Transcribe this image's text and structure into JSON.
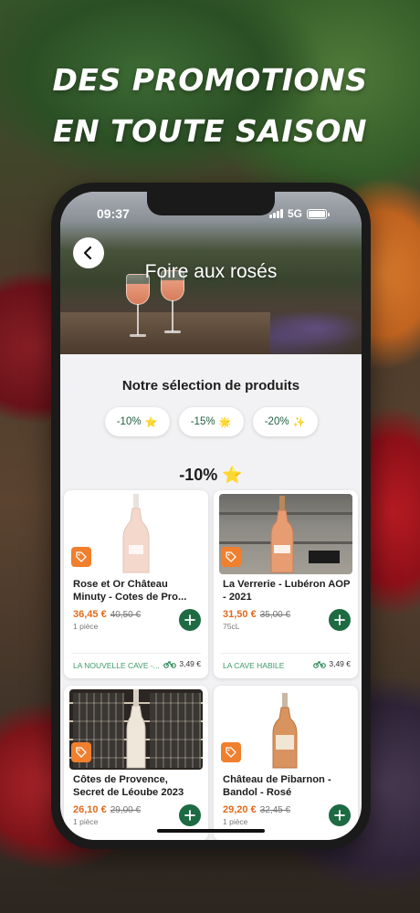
{
  "headline": {
    "line1": "DES PROMOTIONS",
    "line2": "EN TOUTE SAISON"
  },
  "status_bar": {
    "time": "09:37",
    "network": "5G"
  },
  "page": {
    "title": "Foire aux rosés"
  },
  "selection": {
    "title": "Notre sélection de produits",
    "chips": [
      {
        "label": "-10%",
        "emoji": "⭐"
      },
      {
        "label": "-15%",
        "emoji": "🌟"
      },
      {
        "label": "-20%",
        "emoji": "✨"
      }
    ]
  },
  "group": {
    "title": "-10%",
    "emoji": "⭐"
  },
  "products": [
    {
      "name": "Rose et Or Château Minuty - Cotes de Pro...",
      "price": "36,45 €",
      "old_price": "40,50 €",
      "unit": "1 pièce",
      "shop": "LA NOUVELLE CAVE -...",
      "delivery_fee": "3,49 €"
    },
    {
      "name": "La Verrerie - Lubéron AOP - 2021",
      "price": "31,50 €",
      "old_price": "35,00 €",
      "unit": "75cL",
      "shop": "LA CAVE HABILE",
      "delivery_fee": "3,49 €"
    },
    {
      "name": "Côtes de Provence, Secret de Léoube 2023",
      "price": "26,10 €",
      "old_price": "29,00 €",
      "unit": "1 pièce"
    },
    {
      "name": "Château de Pibarnon - Bandol - Rosé",
      "price": "29,20 €",
      "old_price": "32,45 €",
      "unit": "1 pièce"
    }
  ],
  "colors": {
    "accent_green": "#1d6a43",
    "price_orange": "#e26a1c",
    "tag_orange": "#f07f2e",
    "shop_green": "#3b9a67"
  }
}
